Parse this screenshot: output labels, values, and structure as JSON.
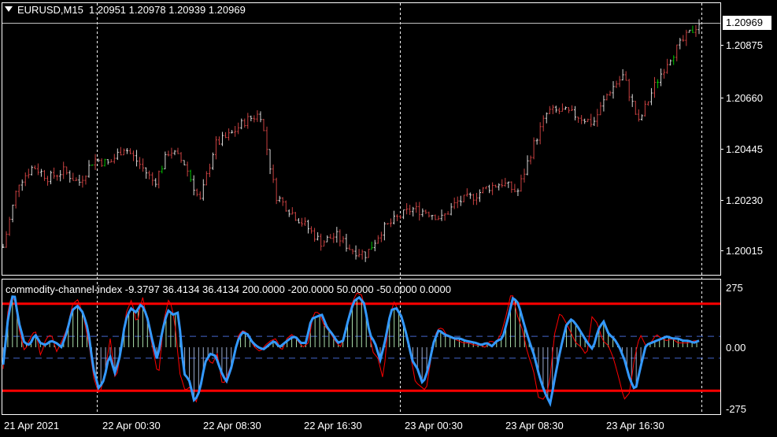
{
  "header": {
    "symbol_timeframe": "EURUSD,M15",
    "ohlc": "1.20951 1.20978 1.20939 1.20969"
  },
  "price_axis": {
    "current": "1.20969",
    "ticks": [
      "1.20875",
      "1.20660",
      "1.20445",
      "1.20230",
      "1.20015"
    ]
  },
  "indicator": {
    "label": "commodity-channel-index -9.3797 36.4134 36.4134 200.0000 -200.0000 50.0000 -50.0000 0.0000",
    "ticks": [
      "275",
      "0.00",
      "-275"
    ]
  },
  "time_axis": [
    "21 Apr 2021",
    "22 Apr 00:30",
    "22 Apr 08:30",
    "22 Apr 16:30",
    "23 Apr 00:30",
    "23 Apr 08:30",
    "23 Apr 16:30"
  ],
  "colors": {
    "background": "#000000",
    "bull_bar": "#00c000",
    "bear_bar": "#c84040",
    "cci_main": "#3399ff",
    "cci_signal": "#ff0000",
    "level_line": "#ff0000",
    "histogram": "#aaddaa"
  },
  "chart_data": [
    {
      "type": "ohlc",
      "title": "EURUSD,M15",
      "ylim": [
        1.199,
        1.2108
      ],
      "x": [
        "21 Apr 2021",
        "22 Apr 00:30",
        "22 Apr 08:30",
        "22 Apr 16:30",
        "23 Apr 00:30",
        "23 Apr 08:30",
        "23 Apr 16:30"
      ],
      "close_path": [
        1.2003,
        1.203,
        1.2037,
        1.2032,
        1.2035,
        1.203,
        1.204,
        1.2038,
        1.2045,
        1.2038,
        1.203,
        1.2044,
        1.2038,
        1.2022,
        1.2046,
        1.205,
        1.2056,
        1.2059,
        1.2025,
        1.2018,
        1.2012,
        1.2005,
        1.2008,
        1.2002,
        1.2,
        1.201,
        1.2015,
        1.2019,
        1.2018,
        1.2015,
        1.2022,
        1.2024,
        1.2028,
        1.203,
        1.2026,
        1.2045,
        1.206,
        1.206,
        1.2058,
        1.2055,
        1.2068,
        1.2075,
        1.2055,
        1.207,
        1.2082,
        1.209,
        1.2097
      ]
    },
    {
      "type": "line",
      "title": "commodity-channel-index",
      "ylim": [
        -275,
        275
      ],
      "levels": [
        200,
        -200,
        50,
        -50,
        0
      ],
      "series": [
        {
          "name": "main",
          "values": [
            -80,
            150,
            260,
            110,
            20,
            10,
            60,
            20,
            10,
            30,
            20,
            0,
            70,
            170,
            190,
            160,
            80,
            -100,
            -190,
            -150,
            -30,
            -120,
            -40,
            120,
            180,
            160,
            200,
            150,
            40,
            -60,
            80,
            170,
            150,
            160,
            -120,
            -150,
            -250,
            -200,
            -70,
            -30,
            -40,
            -110,
            -160,
            -90,
            20,
            70,
            60,
            20,
            0,
            -10,
            10,
            30,
            0,
            20,
            40,
            50,
            20,
            20,
            130,
            140,
            150,
            90,
            60,
            20,
            30,
            130,
            210,
            230,
            200,
            60,
            20,
            -60,
            40,
            170,
            180,
            140,
            50,
            -60,
            -100,
            -170,
            -100,
            20,
            80,
            60,
            50,
            40,
            40,
            30,
            25,
            20,
            10,
            20,
            5,
            30,
            40,
            130,
            230,
            200,
            110,
            30,
            -40,
            -140,
            -210,
            -260,
            -120,
            0,
            100,
            130,
            100,
            60,
            20,
            -10,
            80,
            120,
            60,
            40,
            0,
            -60,
            -150,
            -200,
            -90,
            10,
            20,
            30,
            40,
            50,
            40,
            40,
            30,
            30,
            20,
            30
          ]
        },
        {
          "name": "signal",
          "values": [
            -100,
            200,
            240,
            80,
            -20,
            40,
            80,
            -40,
            40,
            60,
            -20,
            30,
            90,
            200,
            220,
            140,
            20,
            -150,
            -220,
            -120,
            40,
            -160,
            -20,
            160,
            220,
            100,
            240,
            110,
            -10,
            -140,
            120,
            230,
            130,
            -120,
            -200,
            -180,
            -260,
            -150,
            -40,
            -80,
            -30,
            -180,
            -120,
            -60,
            60,
            80,
            40,
            0,
            -20,
            10,
            30,
            40,
            -20,
            40,
            60,
            30,
            0,
            20,
            160,
            160,
            100,
            70,
            30,
            0,
            80,
            190,
            250,
            240,
            130,
            -20,
            -50,
            -150,
            120,
            210,
            160,
            80,
            -20,
            -160,
            -180,
            -200,
            -40,
            80,
            90,
            50,
            40,
            30,
            20,
            20,
            10,
            10,
            0,
            30,
            20,
            60,
            150,
            260,
            150,
            80,
            -30,
            -100,
            -230,
            -240,
            -180,
            60,
            160,
            120,
            70,
            20,
            0,
            -40,
            140,
            110,
            30,
            10,
            -50,
            -140,
            -240,
            -210,
            -40,
            60,
            10,
            20,
            60,
            40,
            30,
            40,
            20,
            20,
            20,
            30,
            30
          ]
        }
      ]
    }
  ]
}
